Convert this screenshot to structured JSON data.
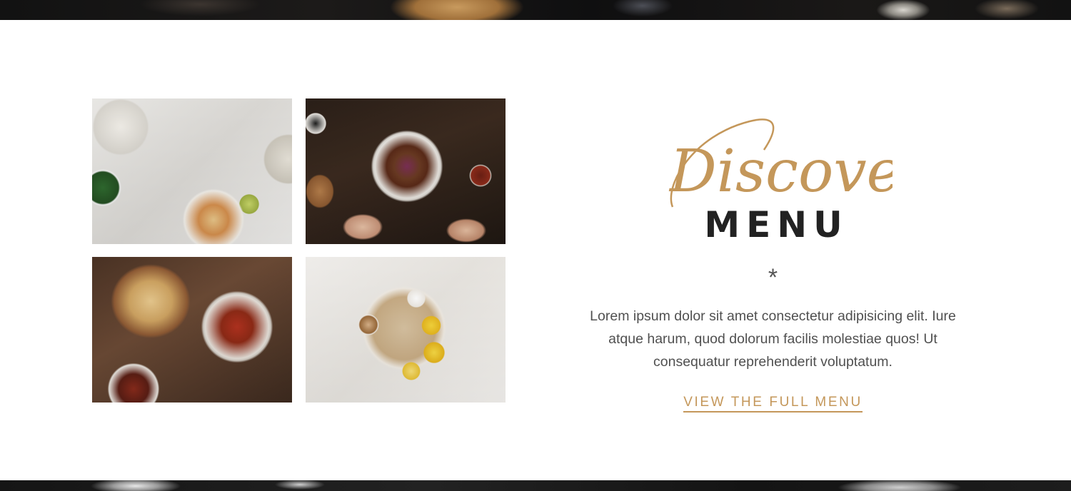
{
  "section": {
    "script_title": "Discover",
    "title": "MENU",
    "divider": "*",
    "description": "Lorem ipsum dolor sit amet consectetur adipisicing elit. Iure atque harum, quod dolorum facilis molestiae quos! Ut consequatur reprehenderit voluptatum.",
    "link_label": "VIEW THE FULL MENU"
  },
  "colors": {
    "accent": "#c4975a",
    "heading": "#222222",
    "body_text": "#505050",
    "banner": "#141414"
  }
}
